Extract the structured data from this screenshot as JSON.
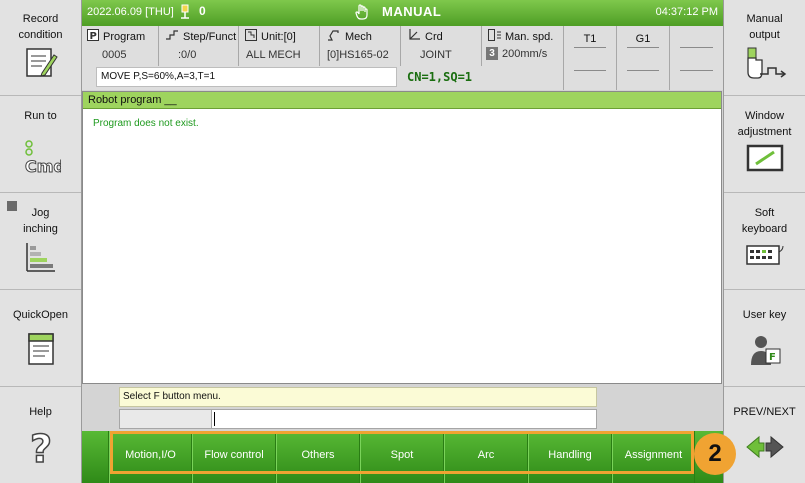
{
  "left_panel": {
    "record_condition": "Record condition",
    "run_to": "Run to",
    "jog_inching": "Jog inching",
    "quick_open": "QuickOpen",
    "help": "Help"
  },
  "right_panel": {
    "manual_output": "Manual output",
    "window_adjustment": "Window adjustment",
    "soft_keyboard": "Soft keyboard",
    "user_key": "User key",
    "prev_next": "PREV/NEXT"
  },
  "header": {
    "date": "2022.06.09 [THU]",
    "alarm_count": "0",
    "mode": "MANUAL",
    "time": "04:37:12 PM"
  },
  "info": {
    "program_label": "Program",
    "program_value": "0005",
    "step_label": "Step/Function",
    "step_value": ":0/0",
    "unit_label": "Unit:[0]",
    "unit_value": "ALL MECH",
    "mech_label": "Mech",
    "mech_value": "[0]HS165-02",
    "crd_label": "Crd",
    "crd_value": "JOINT",
    "speed_label": "Man. spd.",
    "speed_value": "200mm/s",
    "speed_level": "3",
    "t1_label": "T1",
    "g1_label": "G1",
    "command": "MOVE P,S=60%,A=3,T=1",
    "cn_sq": "CN=1,SQ=1"
  },
  "program_pane": {
    "title": "Robot program __",
    "message": "Program does not exist."
  },
  "status": {
    "message": "Select F button menu."
  },
  "fkeys": [
    "Motion,I/O",
    "Flow control",
    "Others",
    "Spot",
    "Arc",
    "Handling",
    "Assignment"
  ],
  "annotation": {
    "number": "2",
    "color": "#f0a332"
  },
  "colors": {
    "accent_green": "#4e9e25",
    "header_green": "#9ed45e",
    "message_green": "#1e9a1e"
  }
}
